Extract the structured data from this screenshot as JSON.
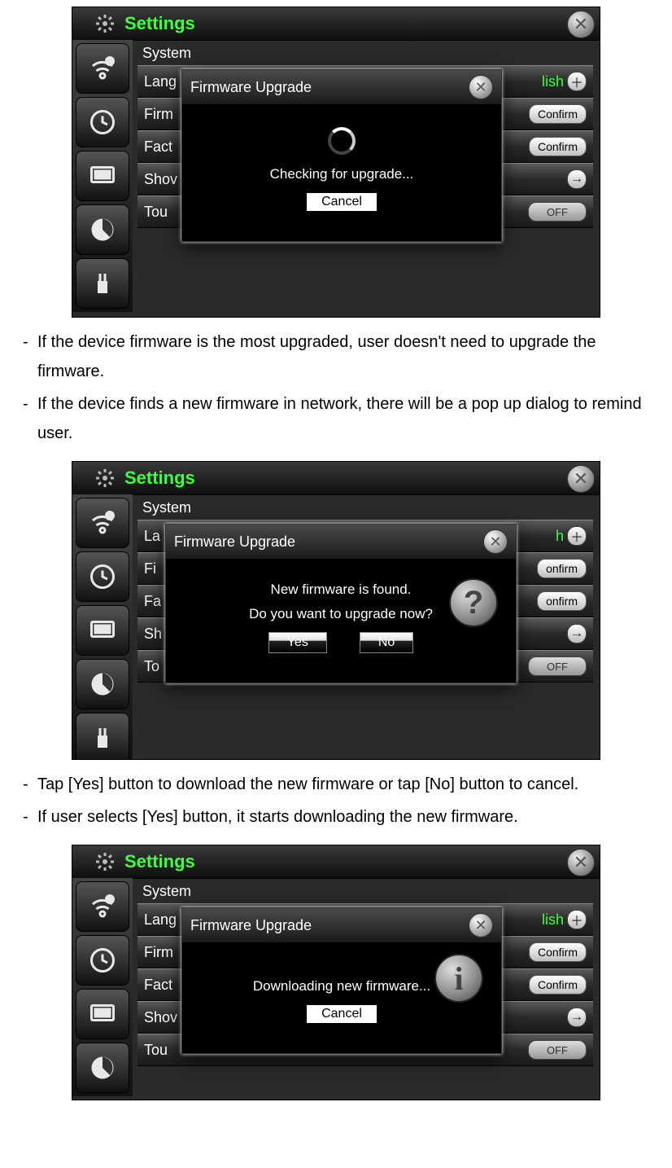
{
  "bullets": [
    "If the device firmware is the most upgraded, user doesn't need to upgrade the firmware.",
    "If the device finds a new firmware in network, there will be a pop up dialog to remind user.",
    "Tap [Yes] button to download the new firmware or tap [No] button to cancel.",
    "If user selects [Yes] button, it starts downloading the new firmware."
  ],
  "settings_title": "Settings",
  "system_label": "System",
  "rows": {
    "lang_full": "Lang",
    "lang_short": "La",
    "firm_full": "Firm",
    "firm_short": "Fi",
    "fact_full": "Fact",
    "fact_short": "Fa",
    "show_full": "Shov",
    "show_short": "Sh",
    "touch_full": "Tou",
    "touch_short": "To"
  },
  "right": {
    "lish": "lish",
    "h": "h",
    "confirm": "Confirm",
    "onfirm": "onfirm",
    "off": "OFF"
  },
  "modal": {
    "title": "Firmware Upgrade",
    "checking": "Checking for upgrade...",
    "found1": "New firmware is found.",
    "found2": "Do you want to upgrade now?",
    "downloading": "Downloading new firmware...",
    "cancel": "Cancel",
    "yes": "Yes",
    "no": "No"
  }
}
